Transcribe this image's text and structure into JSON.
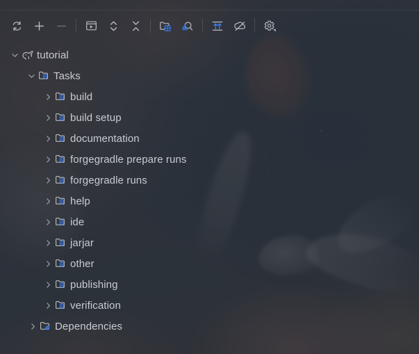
{
  "window": {
    "title": "Gradle Tool Window"
  },
  "toolbar": {
    "buttons": [
      {
        "name": "refresh-button",
        "icon": "refresh-icon",
        "label": "Reload All Gradle Projects",
        "enabled": true
      },
      {
        "name": "add-button",
        "icon": "plus-icon",
        "label": "Link Gradle Project",
        "enabled": true
      },
      {
        "name": "remove-button",
        "icon": "minus-icon",
        "label": "Detach Gradle Project",
        "enabled": false
      },
      {
        "name": "run-task-button",
        "icon": "run-window-icon",
        "label": "Execute Gradle Task",
        "enabled": true
      },
      {
        "name": "expand-all-button",
        "icon": "expand-all-icon",
        "label": "Expand All",
        "enabled": true
      },
      {
        "name": "collapse-all-button",
        "icon": "collapse-all-icon",
        "label": "Collapse All",
        "enabled": true
      },
      {
        "name": "module-settings-button",
        "icon": "folder-grid-icon",
        "label": "Open Module Settings",
        "enabled": true
      },
      {
        "name": "profiler-button",
        "icon": "magnifier-bars-icon",
        "label": "Analyze Dependencies",
        "enabled": true
      },
      {
        "name": "sync-button",
        "icon": "arrows-up-icon",
        "label": "Sync Gradle Project",
        "enabled": true
      },
      {
        "name": "offline-mode-button",
        "icon": "cloud-off-icon",
        "label": "Toggle Offline Mode",
        "enabled": true
      },
      {
        "name": "settings-button",
        "icon": "gear-dropdown-icon",
        "label": "Gradle Settings",
        "enabled": true
      }
    ],
    "separators_after": [
      2,
      5,
      7,
      9
    ]
  },
  "tree": {
    "nodes": [
      {
        "label": "tutorial",
        "level": 0,
        "icon": "gradle-elephant-icon",
        "expanded": true,
        "twisty": "chevron-down"
      },
      {
        "label": "Tasks",
        "level": 1,
        "icon": "task-folder-icon",
        "expanded": true,
        "twisty": "chevron-down"
      },
      {
        "label": "build",
        "level": 2,
        "icon": "task-folder-icon",
        "expanded": false,
        "twisty": "chevron-right"
      },
      {
        "label": "build setup",
        "level": 2,
        "icon": "task-folder-icon",
        "expanded": false,
        "twisty": "chevron-right"
      },
      {
        "label": "documentation",
        "level": 2,
        "icon": "task-folder-icon",
        "expanded": false,
        "twisty": "chevron-right"
      },
      {
        "label": "forgegradle prepare runs",
        "level": 2,
        "icon": "task-folder-icon",
        "expanded": false,
        "twisty": "chevron-right"
      },
      {
        "label": "forgegradle runs",
        "level": 2,
        "icon": "task-folder-icon",
        "expanded": false,
        "twisty": "chevron-right"
      },
      {
        "label": "help",
        "level": 2,
        "icon": "task-folder-icon",
        "expanded": false,
        "twisty": "chevron-right"
      },
      {
        "label": "ide",
        "level": 2,
        "icon": "task-folder-icon",
        "expanded": false,
        "twisty": "chevron-right"
      },
      {
        "label": "jarjar",
        "level": 2,
        "icon": "task-folder-icon",
        "expanded": false,
        "twisty": "chevron-right"
      },
      {
        "label": "other",
        "level": 2,
        "icon": "task-folder-icon",
        "expanded": false,
        "twisty": "chevron-right"
      },
      {
        "label": "publishing",
        "level": 2,
        "icon": "task-folder-icon",
        "expanded": false,
        "twisty": "chevron-right"
      },
      {
        "label": "verification",
        "level": 2,
        "icon": "task-folder-icon",
        "expanded": false,
        "twisty": "chevron-right"
      },
      {
        "label": "Dependencies",
        "level": 1,
        "icon": "dependency-folder-icon",
        "expanded": false,
        "twisty": "chevron-right"
      }
    ]
  },
  "colors": {
    "text": "#c8ccd2",
    "accent_blue": "#3d7ff5",
    "toolbar_icon": "#b6bac0",
    "background": "#2f3237"
  }
}
